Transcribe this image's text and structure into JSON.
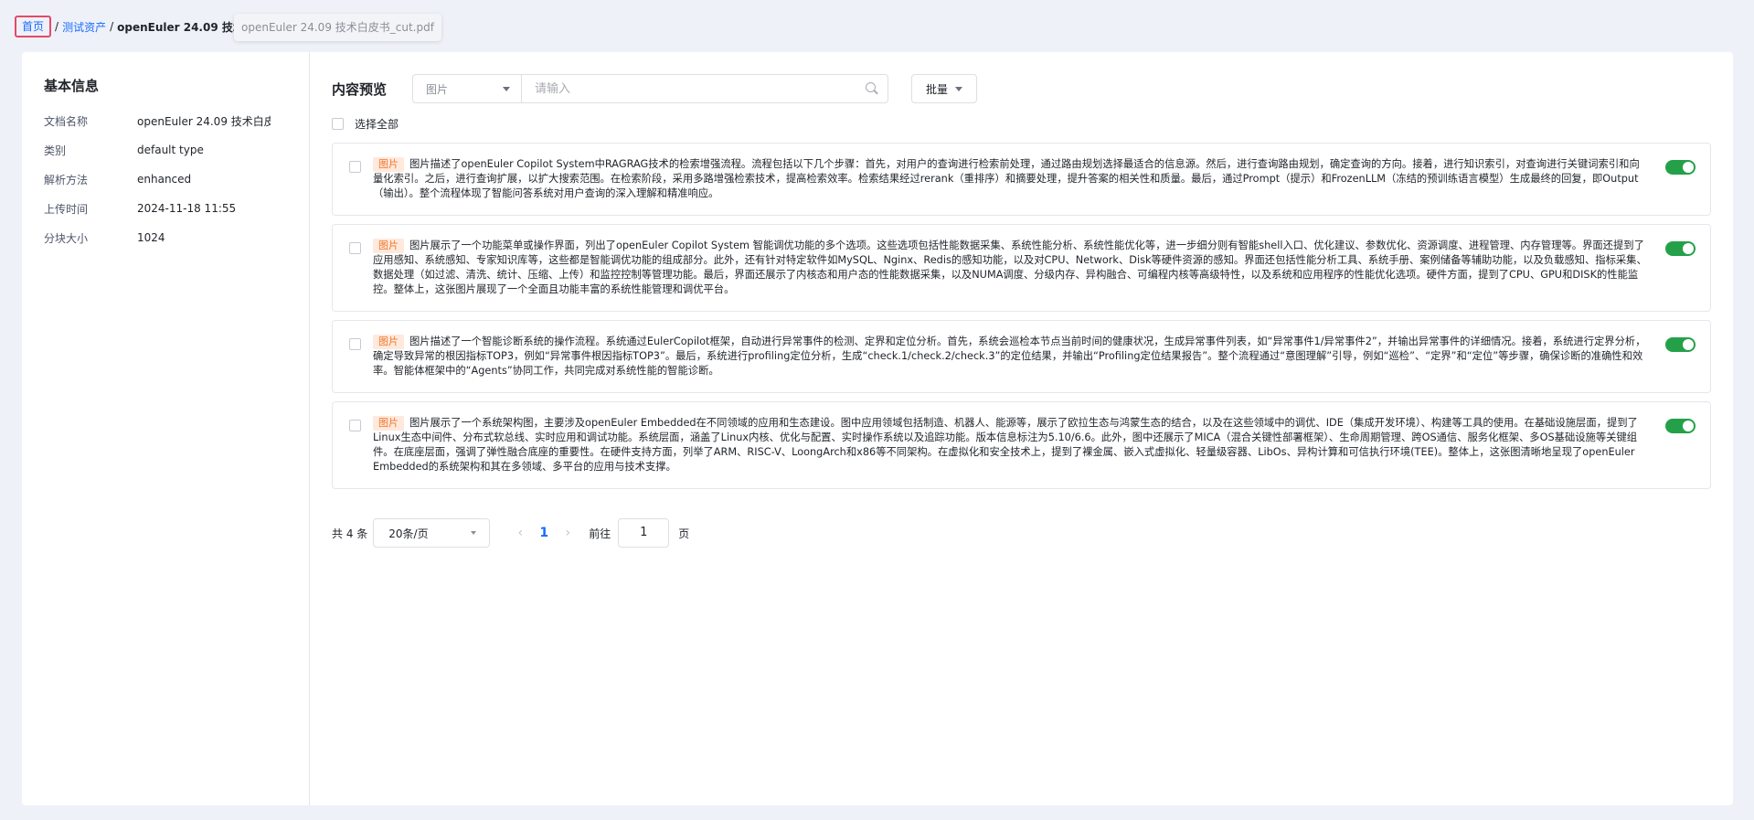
{
  "breadcrumb": {
    "home": "首页",
    "sep": "/",
    "assets": "测试资产",
    "current": "openEuler 24.09 技术白皮书_cut.pdf",
    "tooltip": "openEuler 24.09 技术白皮书_cut.pdf"
  },
  "basic_info": {
    "title": "基本信息",
    "rows": [
      {
        "label": "文档名称",
        "value": "openEuler 24.09 技术白皮书_cut.pdf"
      },
      {
        "label": "类别",
        "value": "default type"
      },
      {
        "label": "解析方法",
        "value": "enhanced"
      },
      {
        "label": "上传时间",
        "value": "2024-11-18 11:55"
      },
      {
        "label": "分块大小",
        "value": "1024"
      }
    ]
  },
  "preview": {
    "title": "内容预览",
    "type_select": "图片",
    "search_placeholder": "请输入",
    "batch_label": "批量",
    "select_all": "选择全部",
    "items": [
      {
        "tag": "图片",
        "enabled": true,
        "text": "图片描述了openEuler Copilot System中RAGRAG技术的检索增强流程。流程包括以下几个步骤：首先，对用户的查询进行检索前处理，通过路由规划选择最适合的信息源。然后，进行查询路由规划，确定查询的方向。接着，进行知识索引，对查询进行关键词索引和向量化索引。之后，进行查询扩展，以扩大搜索范围。在检索阶段，采用多路增强检索技术，提高检索效率。检索结果经过rerank（重排序）和摘要处理，提升答案的相关性和质量。最后，通过Prompt（提示）和FrozenLLM（冻结的预训练语言模型）生成最终的回复，即Output（输出）。整个流程体现了智能问答系统对用户查询的深入理解和精准响应。"
      },
      {
        "tag": "图片",
        "enabled": true,
        "text": "图片展示了一个功能菜单或操作界面，列出了openEuler Copilot System 智能调优功能的多个选项。这些选项包括性能数据采集、系统性能分析、系统性能优化等，进一步细分则有智能shell入口、优化建议、参数优化、资源调度、进程管理、内存管理等。界面还提到了应用感知、系统感知、专家知识库等，这些都是智能调优功能的组成部分。此外，还有针对特定软件如MySQL、Nginx、Redis的感知功能，以及对CPU、Network、Disk等硬件资源的感知。界面还包括性能分析工具、系统手册、案例储备等辅助功能，以及负载感知、指标采集、数据处理（如过滤、清洗、统计、压缩、上传）和监控控制等管理功能。最后，界面还展示了内核态和用户态的性能数据采集，以及NUMA调度、分级内存、异构融合、可编程内核等高级特性，以及系统和应用程序的性能优化选项。硬件方面，提到了CPU、GPU和DISK的性能监控。整体上，这张图片展现了一个全面且功能丰富的系统性能管理和调优平台。"
      },
      {
        "tag": "图片",
        "enabled": true,
        "text": "图片描述了一个智能诊断系统的操作流程。系统通过EulerCopilot框架，自动进行异常事件的检测、定界和定位分析。首先，系统会巡检本节点当前时间的健康状况，生成异常事件列表，如“异常事件1/异常事件2”，并输出异常事件的详细情况。接着，系统进行定界分析，确定导致异常的根因指标TOP3，例如“异常事件根因指标TOP3”。最后，系统进行profiling定位分析，生成“check.1/check.2/check.3”的定位结果，并输出“Profiling定位结果报告”。整个流程通过“意图理解”引导，例如“巡检”、“定界”和“定位”等步骤，确保诊断的准确性和效率。智能体框架中的“Agents”协同工作，共同完成对系统性能的智能诊断。"
      },
      {
        "tag": "图片",
        "enabled": true,
        "text": "图片展示了一个系统架构图，主要涉及openEuler Embedded在不同领域的应用和生态建设。图中应用领域包括制造、机器人、能源等，展示了欧拉生态与鸿蒙生态的结合，以及在这些领域中的调优、IDE（集成开发环境）、构建等工具的使用。在基础设施层面，提到了Linux生态中间件、分布式软总线、实时应用和调试功能。系统层面，涵盖了Linux内核、优化与配置、实时操作系统以及追踪功能。版本信息标注为5.10/6.6。此外，图中还展示了MICA（混合关键性部署框架）、生命周期管理、跨OS通信、服务化框架、多OS基础设施等关键组件。在底座层面，强调了弹性融合底座的重要性。在硬件支持方面，列举了ARM、RISC-V、LoongArch和x86等不同架构。在虚拟化和安全技术上，提到了裸金属、嵌入式虚拟化、轻量级容器、LibOs、异构计算和可信执行环境(TEE)。整体上，这张图清晰地呈现了openEuler Embedded的系统架构和其在多领域、多平台的应用与技术支撑。"
      }
    ]
  },
  "pagination": {
    "total": "共 4 条",
    "page_size": "20条/页",
    "prev": "‹",
    "current_page": "1",
    "next": "›",
    "goto_label": "前往",
    "goto_value": "1",
    "page_unit": "页"
  },
  "colors": {
    "accent": "#1a6bff",
    "toggle_on": "#24a148",
    "tag_bg": "#ffe9dc",
    "tag_text": "#f2782e"
  }
}
